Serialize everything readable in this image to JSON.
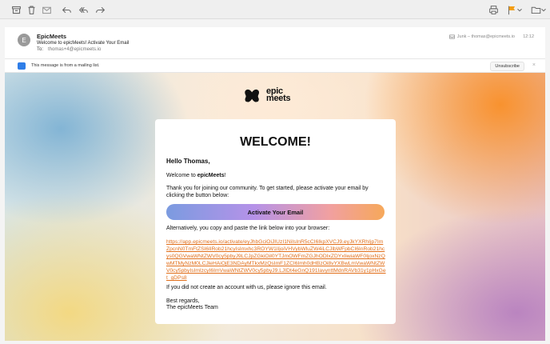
{
  "toolbar": {
    "icons": [
      "archive-icon",
      "trash-icon",
      "junk-icon",
      "reply-icon",
      "reply-all-icon",
      "forward-icon",
      "print-icon",
      "flag-icon",
      "chevron-down-icon",
      "move-to-folder-icon"
    ],
    "flag_color": "#f39c12"
  },
  "message": {
    "avatar_initial": "E",
    "sender": "EpicMeets",
    "subject": "Welcome to epicMeets! Activate Your Email",
    "to_label": "To:",
    "to_address": "thomas+4@epicmeets.io",
    "folder": "Junk – thomas@epicmeets.io",
    "time": "12:12"
  },
  "mailing_list": {
    "notice": "This message is from a mailing list.",
    "unsubscribe_label": "Unsubscribe",
    "close_symbol": "×"
  },
  "email": {
    "logo_top": "epic",
    "logo_bottom": "meets",
    "heading": "WELCOME!",
    "greeting": "Hello Thomas,",
    "intro_prefix": "Welcome to ",
    "intro_brand": "epicMeets",
    "intro_suffix": "!",
    "thanks": "Thank you for joining our community. To get started, please activate your email by clicking the button below:",
    "cta_label": "Activate Your Email",
    "alt_text": "Alternatively, you copy and paste the link below into your browser:",
    "activation_link": "https://app.epicmeets.io/activate/eyJhbGciOiJIUzI1NiIsInR5cCI6IkpXVCJ9.eyJkYXRhIjp7ImZpcnN0TmFtZSI6IlRob21hcyIsImxhc3ROYW1lIjoiVHVybWluZW4iLCJlbWFpbCI6InRob21hcys0QGVwaWNtZWV0cy5pbyJ9LCJpZGkiOiI0YTJmOWFmZGJhODIxZDYxIiwiaWF0IjoxNzQwMTMyNzM0LCJleHAiOjE3NDAyMTkxMzQsImF1ZCI6Imh0dHBzOi8vYXBwLmVwaWNtZWV0cy5pbyIsImlzcyI6ImVwaWNtZWV0cy5pbyJ9.LJIDt4eGnQ191IavynttMdnRAVb31y1pHxGet_gDPs8",
    "ignore_text": "If you did not create an account with us, please ignore this email.",
    "regards": "Best regards,",
    "signature": "The epicMeets Team",
    "link_color": "#e16f1b"
  }
}
